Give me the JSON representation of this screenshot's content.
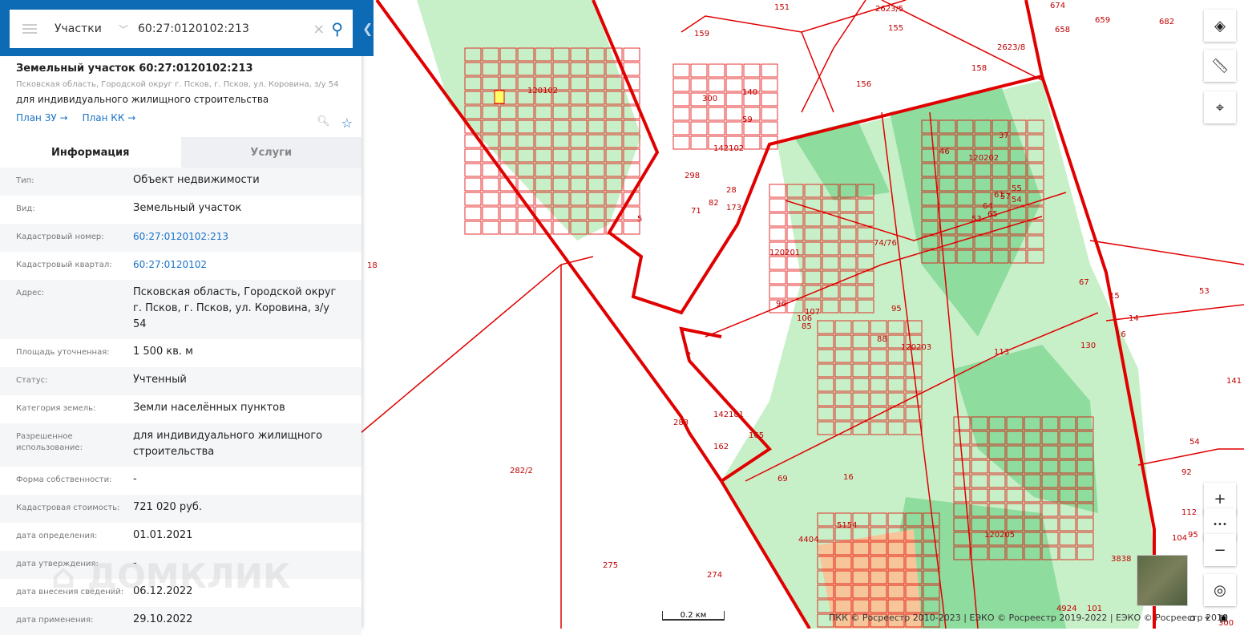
{
  "search": {
    "layer": "Участки",
    "value": "60:27:0120102:213"
  },
  "object": {
    "title": "Земельный участок 60:27:0120102:213",
    "address": "Псковская область, Городской округ г. Псков, г. Псков, ул. Коровина, з/у 54",
    "use": "для индивидуального жилищного строительства",
    "link_zu": "План ЗУ →",
    "link_kk": "План КК →"
  },
  "tabs": [
    "Информация",
    "Услуги"
  ],
  "rows": [
    {
      "k": "Тип:",
      "v": "Объект недвижимости"
    },
    {
      "k": "Вид:",
      "v": "Земельный участок"
    },
    {
      "k": "Кадастровый номер:",
      "v": "60:27:0120102:213"
    },
    {
      "k": "Кадастровый квартал:",
      "v": "60:27:0120102"
    },
    {
      "k": "Адрес:",
      "v": "Псковская область, Городской округ г. Псков, г. Псков, ул. Коровина, з/у 54"
    },
    {
      "k": "Площадь уточненная:",
      "v": "1 500 кв. м"
    },
    {
      "k": "Статус:",
      "v": "Учтенный"
    },
    {
      "k": "Категория земель:",
      "v": "Земли населённых пунктов"
    },
    {
      "k": "Разрешенное использование:",
      "v": "для индивидуального жилищного строительства"
    },
    {
      "k": "Форма собственности:",
      "v": "-"
    },
    {
      "k": "Кадастровая стоимость:",
      "v": "721 020 руб."
    },
    {
      "k": "дата определения:",
      "v": "01.01.2021"
    },
    {
      "k": "дата утверждения:",
      "v": "-"
    },
    {
      "k": "дата внесения сведений:",
      "v": "06.12.2022"
    },
    {
      "k": "дата применения:",
      "v": "29.10.2022"
    }
  ],
  "watermark": "ДОМКЛИК",
  "map": {
    "labels": [
      [
        "151",
        966,
        12
      ],
      [
        "2623/5",
        1092,
        14
      ],
      [
        "674",
        1310,
        10
      ],
      [
        "659",
        1366,
        28
      ],
      [
        "682",
        1446,
        30
      ],
      [
        "658",
        1316,
        40
      ],
      [
        "2623/8",
        1244,
        62
      ],
      [
        "159",
        866,
        45
      ],
      [
        "155",
        1108,
        38
      ],
      [
        "158",
        1212,
        88
      ],
      [
        "156",
        1068,
        108
      ],
      [
        "120102",
        658,
        116
      ],
      [
        "300",
        876,
        126
      ],
      [
        "140",
        926,
        118
      ],
      [
        "59",
        926,
        152
      ],
      [
        "142102",
        890,
        188
      ],
      [
        "298",
        854,
        222
      ],
      [
        "28",
        906,
        240
      ],
      [
        "82",
        884,
        256
      ],
      [
        "173",
        906,
        262
      ],
      [
        "71",
        862,
        266
      ],
      [
        "5",
        795,
        276
      ],
      [
        "120201",
        960,
        318
      ],
      [
        "74/76",
        1090,
        306
      ],
      [
        "120202",
        1208,
        200
      ],
      [
        "46",
        1172,
        192
      ],
      [
        "37",
        1246,
        172
      ],
      [
        "53",
        1212,
        276
      ],
      [
        "55",
        1262,
        238
      ],
      [
        "54",
        1262,
        252
      ],
      [
        "61",
        1240,
        246
      ],
      [
        "57",
        1248,
        248
      ],
      [
        "64",
        1226,
        260
      ],
      [
        "65",
        1232,
        270
      ],
      [
        "67",
        1346,
        355
      ],
      [
        "96",
        968,
        382
      ],
      [
        "106",
        994,
        400
      ],
      [
        "107",
        1004,
        392
      ],
      [
        "85",
        1000,
        410
      ],
      [
        "95",
        1112,
        388
      ],
      [
        "88",
        1094,
        426
      ],
      [
        "120203",
        1124,
        436
      ],
      [
        "113",
        1240,
        442
      ],
      [
        "130",
        1348,
        434
      ],
      [
        "14",
        1408,
        400
      ],
      [
        "16",
        1392,
        420
      ],
      [
        "15",
        1384,
        372
      ],
      [
        "53",
        1496,
        366
      ],
      [
        "18",
        458,
        334
      ],
      [
        "2",
        856,
        446
      ],
      [
        "142101",
        890,
        520
      ],
      [
        "283",
        840,
        530
      ],
      [
        "165",
        934,
        546
      ],
      [
        "162",
        890,
        560
      ],
      [
        "282/2",
        636,
        590
      ],
      [
        "69",
        970,
        600
      ],
      [
        "16",
        1052,
        598
      ],
      [
        "54",
        1484,
        554
      ],
      [
        "92",
        1474,
        592
      ],
      [
        "112",
        1474,
        642
      ],
      [
        "95",
        1482,
        670
      ],
      [
        "104",
        1462,
        674
      ],
      [
        "120205",
        1228,
        670
      ],
      [
        "5154",
        1044,
        658
      ],
      [
        "4404",
        996,
        676
      ],
      [
        "275",
        752,
        708
      ],
      [
        "274",
        882,
        720
      ],
      [
        "3838",
        1386,
        700
      ],
      [
        "4924",
        1318,
        762
      ],
      [
        "101",
        1356,
        762
      ],
      [
        "107",
        1432,
        745
      ],
      [
        "300",
        1520,
        780
      ],
      [
        "141",
        1530,
        478
      ]
    ],
    "scale": "0.2 км",
    "attribution": "ПКК © Росреестр 2010-2023 | ЕЭКО © Росреестр 2019-2022 | ЕЭКО © Росреестр 2010"
  },
  "controls": {
    "zoom_in": "+",
    "more": "•••",
    "zoom_out": "−"
  }
}
